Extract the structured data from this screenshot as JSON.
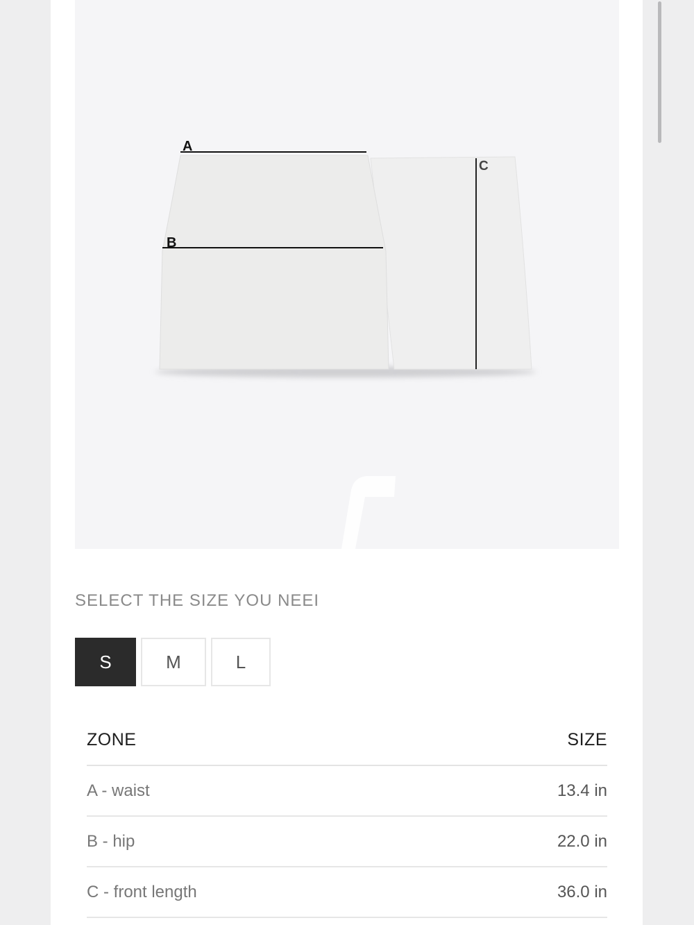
{
  "image": {
    "labels": [
      "A",
      "B",
      "C"
    ]
  },
  "size_selector": {
    "prompt": "SELECT THE SIZE YOU NEEI",
    "options": [
      "S",
      "M",
      "L"
    ],
    "selected": "S"
  },
  "measurements": {
    "headers": {
      "zone": "ZONE",
      "size": "SIZE"
    },
    "rows": [
      {
        "zone": "A - waist",
        "size": "13.4 in"
      },
      {
        "zone": "B - hip",
        "size": "22.0 in"
      },
      {
        "zone": "C - front length",
        "size": "36.0 in"
      }
    ]
  },
  "colors": {
    "selected_bg": "#2b2b2b",
    "image_bg": "#f5f5f7"
  }
}
